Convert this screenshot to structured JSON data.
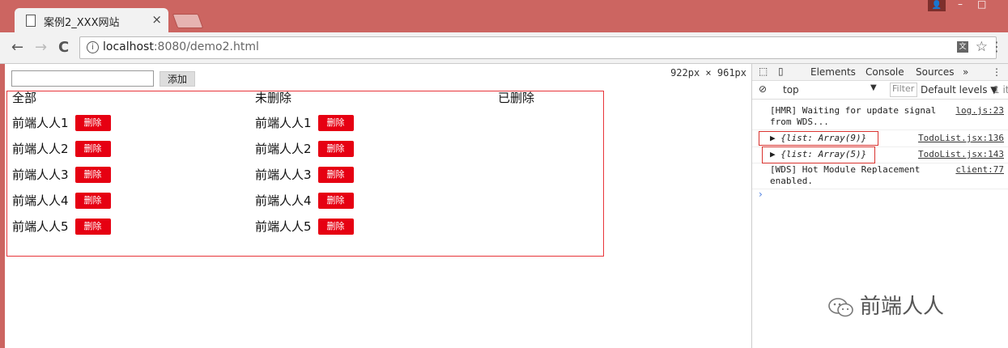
{
  "browser": {
    "tab_title": "案例2_XXX网站",
    "tab_close": "×",
    "url_host": "localhost",
    "url_rest": ":8080/demo2.html",
    "back": "←",
    "forward": "→",
    "reload": "C",
    "info_glyph": "i",
    "star_glyph": "☆",
    "menu_glyph": "⋮",
    "translate_glyph": "文",
    "user_glyph": "👤",
    "minimize_glyph": "–",
    "maximize_glyph": "□"
  },
  "viewport": {
    "dims": "922px × 961px"
  },
  "page": {
    "input_value": "",
    "add_label": "添加",
    "columns": [
      {
        "header": "全部",
        "items": [
          "前端人人1",
          "前端人人2",
          "前端人人3",
          "前端人人4",
          "前端人人5"
        ]
      },
      {
        "header": "未删除",
        "items": [
          "前端人人1",
          "前端人人2",
          "前端人人3",
          "前端人人4",
          "前端人人5"
        ]
      },
      {
        "header": "已删除",
        "items": []
      }
    ],
    "delete_label": "删除"
  },
  "devtools": {
    "tabs": [
      "Elements",
      "Console",
      "Sources",
      "»"
    ],
    "context": "top",
    "filter_placeholder": "Filter",
    "levels": "Default levels ▼",
    "issues": "1 ite",
    "lines": [
      {
        "msg": "[HMR] Waiting for update signal",
        "msg2": "from WDS...",
        "src": "log.js:23"
      },
      {
        "msg": "▶ {list: Array(9)}",
        "src": "TodoList.jsx:136"
      },
      {
        "msg": "▶ {list: Array(5)}",
        "src": "TodoList.jsx:143"
      },
      {
        "msg": "[WDS] Hot Module Replacement",
        "msg2": "enabled.",
        "src": "client:77"
      }
    ],
    "prompt": "›"
  },
  "watermark": "前端人人",
  "colors": {
    "frame": "#cc6561",
    "delete_btn": "#e60012",
    "box_border": "#e8353a"
  }
}
